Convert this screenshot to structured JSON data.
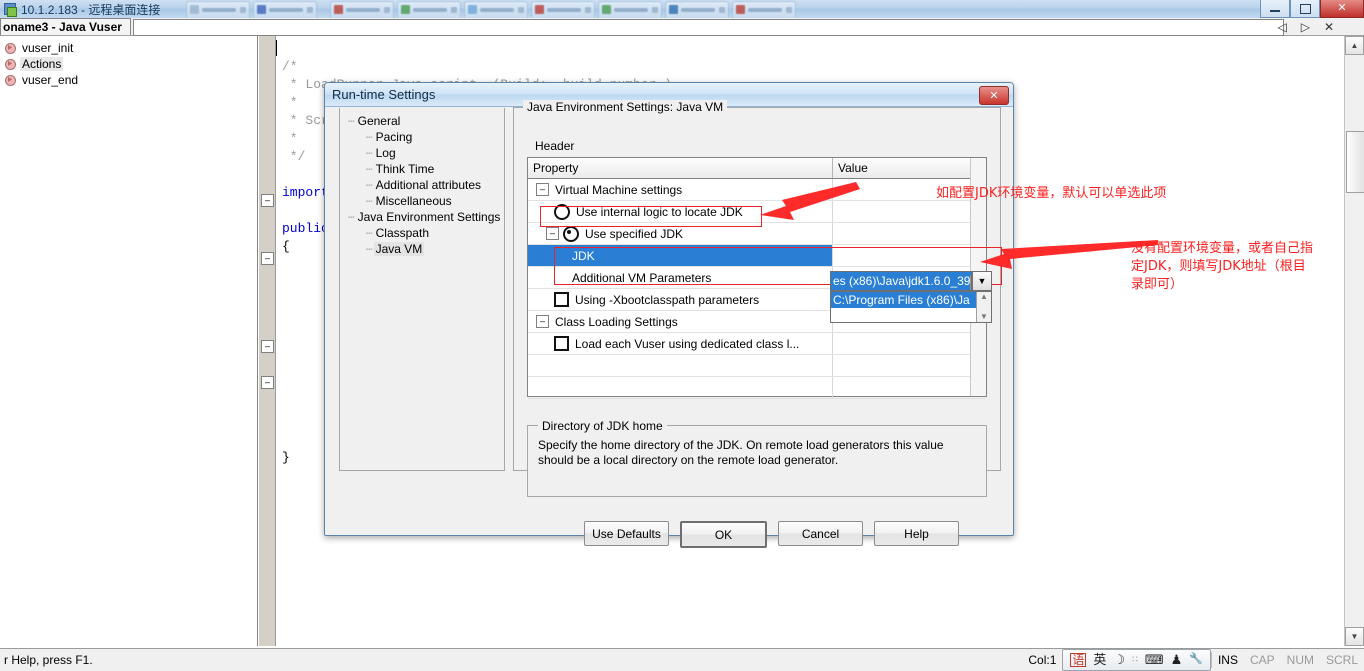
{
  "rdp": {
    "title": "10.1.2.183 - 远程桌面连接",
    "icon": "remote-desktop-icon",
    "window_buttons": {
      "minimize": "–",
      "restore": "❐",
      "close": "✕"
    }
  },
  "mdi": {
    "tab_title": "oname3 - Java Vuser",
    "controls": {
      "prev": "◁",
      "next": "▷",
      "close": "✕"
    }
  },
  "script_tree": {
    "items": [
      {
        "label": "vuser_init",
        "selected": false
      },
      {
        "label": "Actions",
        "selected": true
      },
      {
        "label": "vuser_end",
        "selected": false
      }
    ]
  },
  "editor": {
    "lines": [
      {
        "text": "/*",
        "style": "comment"
      },
      {
        "text": " * LoadRunner Java script. (Build: _build_number_)",
        "style": "comment"
      },
      {
        "text": " *",
        "style": "comment"
      },
      {
        "text": " * Scr",
        "style": "comment"
      },
      {
        "text": " *",
        "style": "comment"
      },
      {
        "text": " */",
        "style": "comment"
      },
      {
        "text": "",
        "style": "plain"
      },
      {
        "text": "import",
        "style": "keyword"
      },
      {
        "text": "",
        "style": "plain"
      },
      {
        "text": "public",
        "style": "keyword"
      },
      {
        "text": "{",
        "style": "plain"
      }
    ],
    "closing_brace": "}",
    "fold_marker": "–"
  },
  "dialog": {
    "title": "Run-time Settings",
    "close_label": "✕",
    "tree": [
      {
        "label": "General",
        "level": 0,
        "selected": false
      },
      {
        "label": "Pacing",
        "level": 1,
        "selected": false
      },
      {
        "label": "Log",
        "level": 1,
        "selected": false
      },
      {
        "label": "Think Time",
        "level": 1,
        "selected": false
      },
      {
        "label": "Additional attributes",
        "level": 1,
        "selected": false
      },
      {
        "label": "Miscellaneous",
        "level": 1,
        "selected": false
      },
      {
        "label": "Java Environment Settings",
        "level": 0,
        "selected": false
      },
      {
        "label": "Classpath",
        "level": 1,
        "selected": false
      },
      {
        "label": "Java VM",
        "level": 1,
        "selected": true
      }
    ],
    "group_legend": "Java Environment Settings: Java VM",
    "header_label": "Header",
    "grid": {
      "columns": [
        "Property",
        "Value"
      ],
      "rows": [
        {
          "label": "Virtual Machine settings",
          "value": "",
          "control": "expander",
          "expander": "–",
          "indent": 0
        },
        {
          "label": "Use internal logic to locate JDK",
          "value": "",
          "control": "radio",
          "checked": false,
          "indent": 1,
          "highlight": true
        },
        {
          "label": "Use specified JDK",
          "value": "",
          "control": "radio-expander",
          "checked": true,
          "expander": "–",
          "indent": 1
        },
        {
          "label": "JDK",
          "value": "es (x86)\\Java\\jdk1.6.0_39",
          "control": "none",
          "indent": 2,
          "selected": true,
          "editing": true
        },
        {
          "label": "Additional VM Parameters",
          "value": "",
          "control": "none",
          "indent": 2
        },
        {
          "label": "Using -Xbootclasspath parameters",
          "value": "",
          "control": "checkbox",
          "checked": false,
          "indent": 1
        },
        {
          "label": "Class Loading Settings",
          "value": "",
          "control": "expander",
          "expander": "–",
          "indent": 0
        },
        {
          "label": "Load each Vuser using dedicated class l...",
          "value": "",
          "control": "checkbox",
          "checked": false,
          "indent": 1
        },
        {
          "label": "",
          "value": "",
          "control": "none",
          "indent": 0
        },
        {
          "label": "",
          "value": "",
          "control": "none",
          "indent": 0
        }
      ]
    },
    "combo": {
      "value": "es (x86)\\Java\\jdk1.6.0_39",
      "dropdown_arrow": "▼",
      "options": [
        "C:\\Program Files (x86)\\Ja"
      ],
      "scroll_up": "▲",
      "scroll_down": "▼"
    },
    "directory_group": {
      "legend": "Directory of JDK home",
      "text": "Specify the  home directory of the JDK. On remote load generators this value should be a local directory on the remote load generator."
    },
    "buttons": [
      {
        "label": "Use Defaults",
        "default": false
      },
      {
        "label": "OK",
        "default": true
      },
      {
        "label": "Cancel",
        "default": false
      },
      {
        "label": "Help",
        "default": false
      }
    ]
  },
  "annotations": [
    {
      "id": "anno-1",
      "text": "如配置JDK环境变量，默认可以单选此项"
    },
    {
      "id": "anno-2",
      "text": "没有配置环境变量，或者自己指\n定JDK，则填写JDK地址（根目\n录即可）"
    }
  ],
  "statusbar": {
    "help_text": "r Help, press F1.",
    "col": "Col:1",
    "ime": {
      "lang_box": "语",
      "mode": "英",
      "moon": "☽",
      "dots": "∷",
      "keyboard": "⌨",
      "tools": "♟",
      "wrench": "🔧"
    },
    "indicators": [
      {
        "label": "INS",
        "active": true
      },
      {
        "label": "CAP",
        "active": false
      },
      {
        "label": "NUM",
        "active": false
      },
      {
        "label": "SCRL",
        "active": false
      }
    ]
  },
  "colors": {
    "accent_blue": "#2a7fd4",
    "annotation_red": "#ff1f1f",
    "highlight_red": "#e8252a",
    "title_blue": "#0b2a48"
  }
}
